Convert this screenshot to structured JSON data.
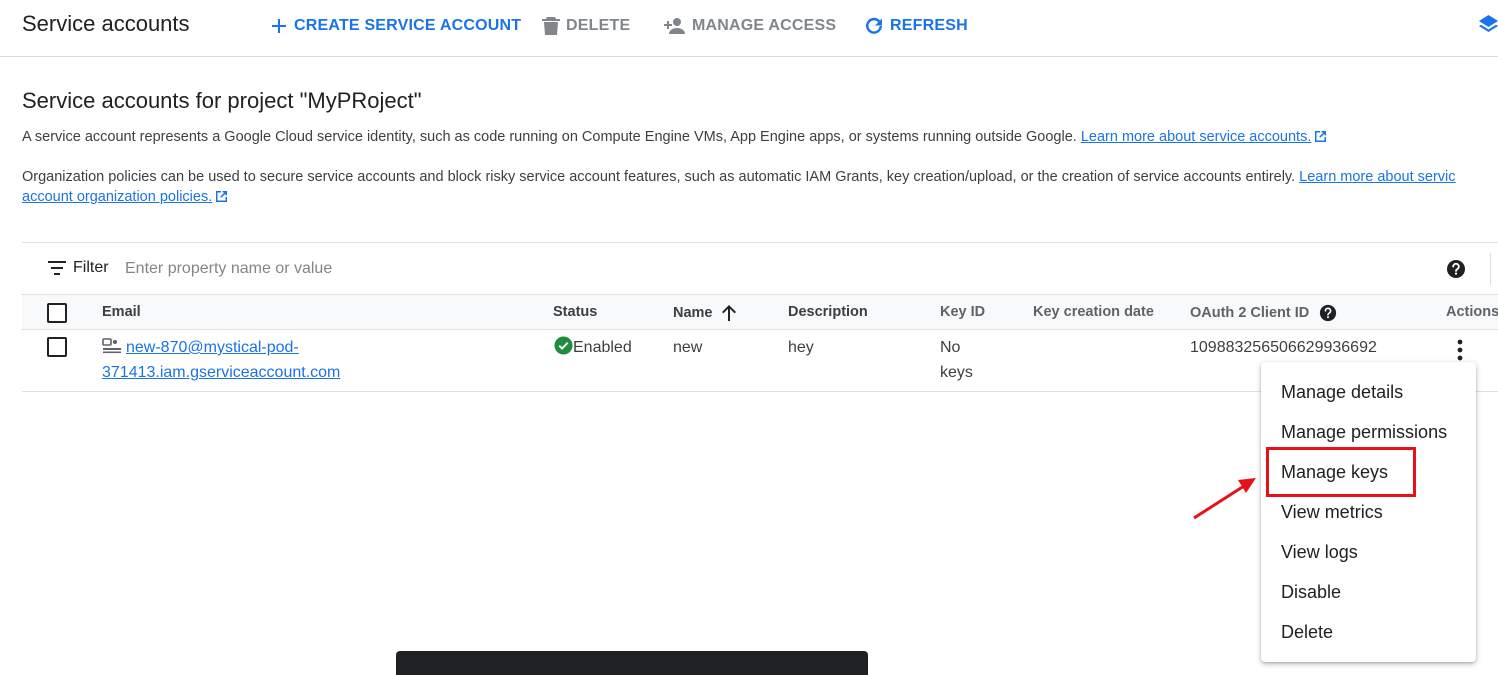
{
  "toolbar": {
    "title": "Service accounts",
    "create_label": "CREATE SERVICE ACCOUNT",
    "delete_label": "DELETE",
    "manage_access_label": "MANAGE ACCESS",
    "refresh_label": "REFRESH"
  },
  "section": {
    "title": "Service accounts for project \"MyPRoject\"",
    "desc1_text": "A service account represents a Google Cloud service identity, such as code running on Compute Engine VMs, App Engine apps, or systems running outside Google.",
    "desc1_link": "Learn more about service accounts.",
    "desc2_text": "Organization policies can be used to secure service accounts and block risky service account features, such as automatic IAM Grants, key creation/upload, or the creation of service accounts entirely.",
    "desc2_link_a": "Learn more about servic",
    "desc2_link_b": "account organization policies."
  },
  "filter": {
    "label": "Filter",
    "placeholder": "Enter property name or value"
  },
  "table": {
    "columns": {
      "email": "Email",
      "status": "Status",
      "name": "Name",
      "description": "Description",
      "key_id": "Key ID",
      "key_creation_date": "Key creation date",
      "oauth_client_id": "OAuth 2 Client ID",
      "actions": "Actions"
    },
    "rows": [
      {
        "email_line1": "new-870@mystical-pod-",
        "email_line2": "371413.iam.gserviceaccount.com",
        "status": "Enabled",
        "name": "new",
        "description": "hey",
        "key_id_line1": "No",
        "key_id_line2": "keys",
        "oauth_client_id": "109883256506629936692"
      }
    ]
  },
  "menu": {
    "items": [
      "Manage details",
      "Manage permissions",
      "Manage keys",
      "View metrics",
      "View logs",
      "Disable",
      "Delete"
    ]
  },
  "colors": {
    "accent": "#1a73e8",
    "success": "#1e8e3e",
    "annotation": "#e8101a"
  }
}
